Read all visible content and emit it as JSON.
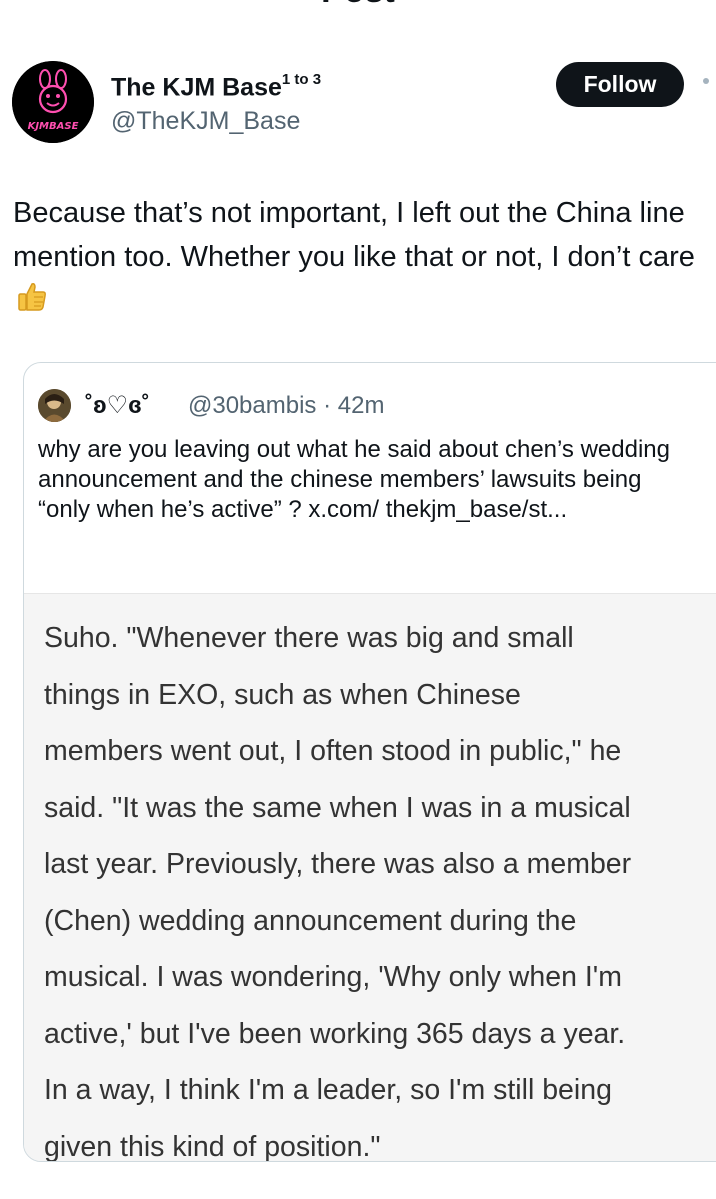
{
  "header": {
    "back_icon": "arrow-left-icon",
    "title": "Post"
  },
  "post": {
    "author": {
      "display_name": "The KJM Base",
      "name_superscript": "1 to 3",
      "handle": "@TheKJM_Base",
      "avatar_logo_text": "KJMBASE"
    },
    "follow_label": "Follow",
    "text": "Because that’s not important, I left out the China line mention too. Whether you like that or not, I don’t care",
    "emoji_icon": "thumbs-up-icon"
  },
  "quote": {
    "display_name": "˚ʚ♡ɞ˚",
    "handle": "@30bambis",
    "separator": "·",
    "time": "42m",
    "text": "why are you leaving out what he said about chen’s wedding announcement and the chinese members’ lawsuits being “only when he’s active” ? x.com/ thekjm_base/st...",
    "image_lines": [
      "Suho. \"Whenever there was big and small",
      "things in EXO, such as when Chinese",
      "members went out, I often stood in public,\" he",
      "said. \"It was the same when I was in a musical",
      "last year. Previously, there was also a member",
      "(Chen) wedding announcement during the",
      "musical. I was wondering, 'Why only when I'm",
      "active,' but I've been working 365 days a year.",
      "In a way, I think I'm a leader, so I'm still being",
      "given this kind of position.\""
    ]
  },
  "colors": {
    "text_primary": "#0f1419",
    "text_secondary": "#536471",
    "border": "#cfd9de",
    "follow_bg": "#0f1419",
    "logo_pink": "#ff4fb0",
    "image_bg": "#f5f5f5",
    "image_text": "#333333"
  }
}
